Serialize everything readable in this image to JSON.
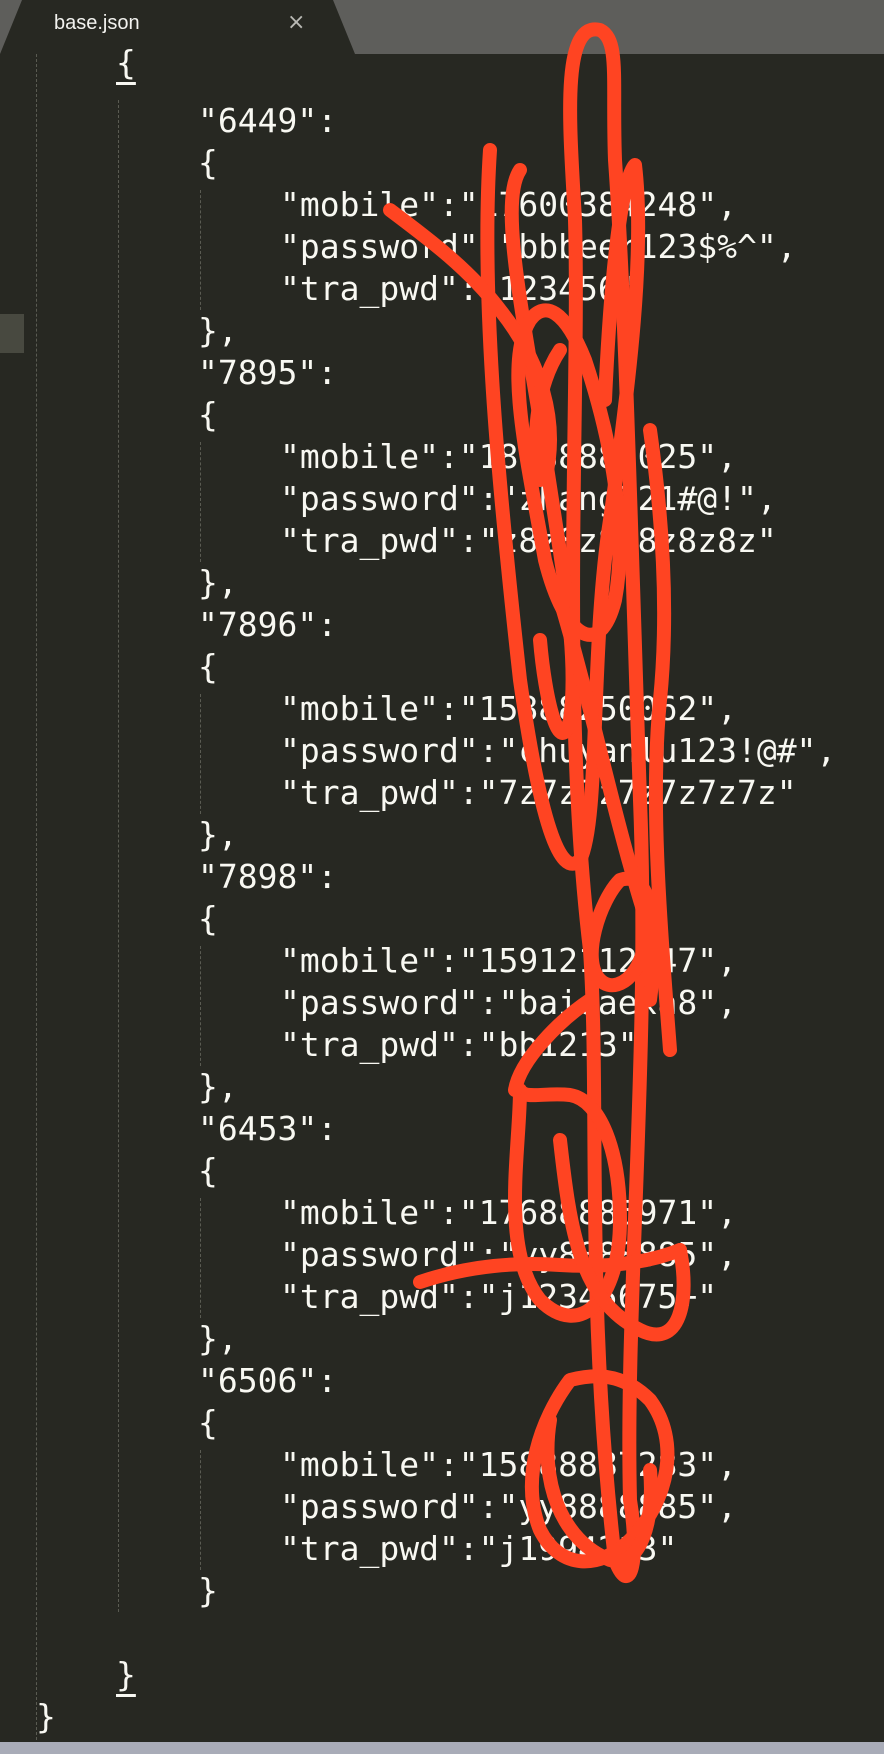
{
  "tab": {
    "title": "base.json",
    "close_glyph": "×"
  },
  "editor": {
    "lines": [
      "{",
      "\"6449\":",
      "{",
      "\"mobile\":\"17600384248\",",
      "\"password\":\"bbbeer123$%^\",",
      "\"tra_pwd\":\"123456\"",
      "},",
      "\"7895\":",
      "{",
      "\"mobile\":\"18688883025\",",
      "\"password\":\"zhang321#@!\",",
      "\"tra_pwd\":\"z8z8z8z8z8z8z\"",
      "},",
      "\"7896\":",
      "{",
      "\"mobile\":\"15888250062\",",
      "\"password\":\"chuyanlu123!@#\",",
      "\"tra_pwd\":\"7z7z7z7z7z7z7z\"",
      "},",
      "\"7898\":",
      "{",
      "\"mobile\":\"15912112047\",",
      "\"password\":\"baidaexa8\",",
      "\"tra_pwd\":\"bb1213\"",
      "},",
      "\"6453\":",
      "{",
      "\"mobile\":\"17688885971\",",
      "\"password\":\"yy8888885\",",
      "\"tra_pwd\":\"j12345675+\"",
      "},",
      "\"6506\":",
      "{",
      "\"mobile\":\"15888887283\",",
      "\"password\":\"yy8888885\",",
      "\"tra_pwd\":\"j1994213\"",
      "}",
      "",
      "}",
      "}"
    ]
  },
  "colors": {
    "background": "#272822",
    "text": "#f8f8f2",
    "tab_bar": "#5e5e5b",
    "redaction": "#ff4422"
  },
  "icons": {
    "tab_close": "close-icon"
  }
}
